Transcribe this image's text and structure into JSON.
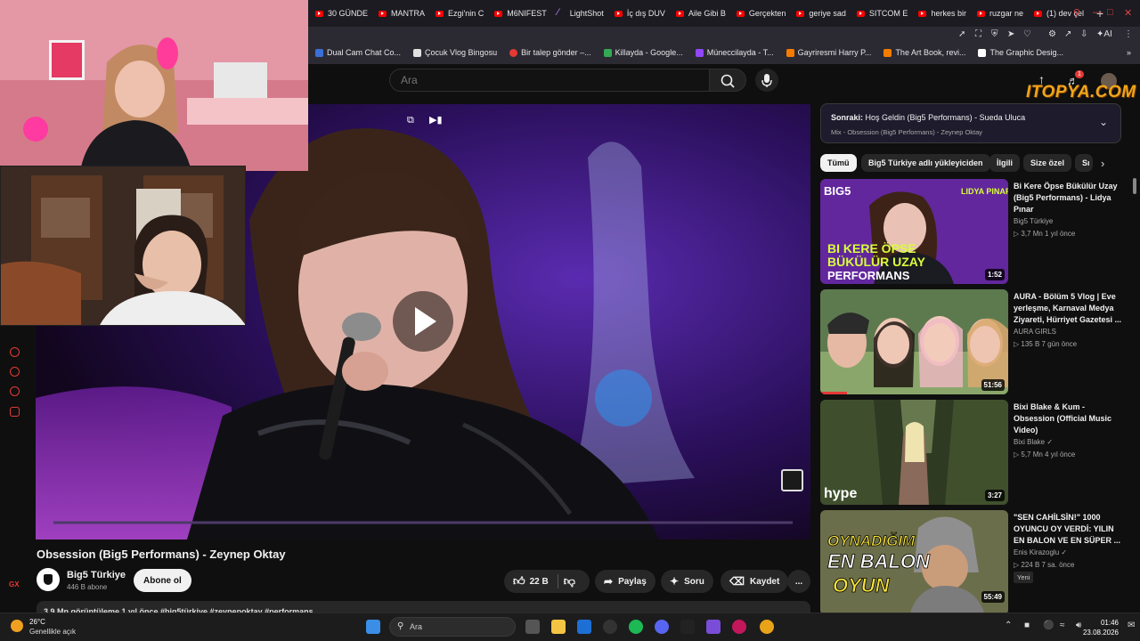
{
  "browser": {
    "tabs": [
      {
        "label": "30 GÜNDE"
      },
      {
        "label": "MANTRA"
      },
      {
        "label": "Ezgi'nin C"
      },
      {
        "label": "M6NIFEST"
      },
      {
        "label": "LightShot"
      },
      {
        "label": "İç dış DUV"
      },
      {
        "label": "Aile Gibi B"
      },
      {
        "label": "Gerçekten"
      },
      {
        "label": "geriye sad"
      },
      {
        "label": "SITCOM E"
      },
      {
        "label": "herkes bir"
      },
      {
        "label": "ruzgar ne"
      },
      {
        "label": "(1) dev çel"
      }
    ],
    "new_tab": "+",
    "toolbar_ai": "AI",
    "bookmarks": [
      {
        "label": "Dual Cam Chat Co...",
        "color": "#3b6fd8"
      },
      {
        "label": "Çocuk Vlog Bingosu",
        "color": "#e0e0e0"
      },
      {
        "label": "Bir talep gönder –...",
        "color": "#e53935"
      },
      {
        "label": "Killayda - Google...",
        "color": "#34a853"
      },
      {
        "label": "Müneccilayda - T...",
        "color": "#9146ff"
      },
      {
        "label": "Gayriresmi Harry P...",
        "color": "#f57c00"
      },
      {
        "label": "The Art Book, revi...",
        "color": "#f57c00"
      },
      {
        "label": "The Graphic Desig...",
        "color": "#ffffff"
      }
    ]
  },
  "youtube": {
    "search_placeholder": "Ara",
    "notifications_count": "1",
    "overlay_logo": "ITOPYA.COM",
    "video": {
      "title": "Obsession (Big5 Performans) - Zeynep Oktay",
      "channel": "Big5 Türkiye",
      "subscribers": "446 B abone",
      "subscribe_label": "Abone ol",
      "likes": "22 B",
      "share_label": "Paylaş",
      "ask_label": "Soru",
      "save_label": "Kaydet",
      "more_label": "...",
      "description_preview": "3,9 Mn görüntüleme  1 yıl önce  #big5türkiye #zeynepoktay #performans"
    },
    "up_next": {
      "prefix": "Sonraki:",
      "title": "Hoş Geldin (Big5 Performans) - Sueda Uluca",
      "mix": "Mix - Obsession (Big5 Performans) - Zeynep Oktay"
    },
    "chips": [
      "Tümü",
      "Big5 Türkiye adlı yükleyiciden",
      "İlgili",
      "Size özel",
      "Sı"
    ],
    "recommendations": [
      {
        "title": "Bi Kere Öpse Bükülür Uzay (Big5 Performans) - Lidya Pınar",
        "channel": "Big5 Türkiye",
        "meta": "▷ 3,7 Mn   1 yıl önce",
        "duration": "1:52",
        "thumb_text_top": "BI KERE ÖPSE",
        "thumb_text_mid": "BÜKÜLÜR UZAY",
        "thumb_text_bot": "PERFORMANS",
        "thumb_label": "LIDYA PINAR",
        "thumb_brand": "BIG5"
      },
      {
        "title": "AURA - Bölüm 5 Vlog | Eve yerleşme, Karnaval Medya Ziyareti, Hürriyet Gazetesi ...",
        "channel": "AURA GIRLS",
        "meta": "▷ 135 B   7 gün önce",
        "duration": "51:56"
      },
      {
        "title": "Bixi Blake & Kum - Obsession (Official Music Video)",
        "channel": "Bixi Blake ✓",
        "meta": "▷ 5,7 Mn   4 yıl önce",
        "duration": "3:27",
        "thumb_brand": "hype"
      },
      {
        "title": "\"SEN CAHİLSİN!\" 1000 OYUNCU OY VERDİ: YILIN EN BALON VE EN SÜPER ...",
        "channel": "Enis Kirazoglu ✓",
        "meta": "▷ 224 B   7 sa. önce",
        "badge": "Yeni",
        "duration": "55:49",
        "thumb_text_top": "OYNADIĞIM",
        "thumb_text_mid": "EN BALON",
        "thumb_text_bot": "OYUN"
      }
    ]
  },
  "sidebar_label": "GX",
  "taskbar": {
    "temperature": "26°C",
    "weather": "Genellikle açık",
    "search_label": "Ara",
    "time": "01:46",
    "date": "23.08.2026"
  }
}
